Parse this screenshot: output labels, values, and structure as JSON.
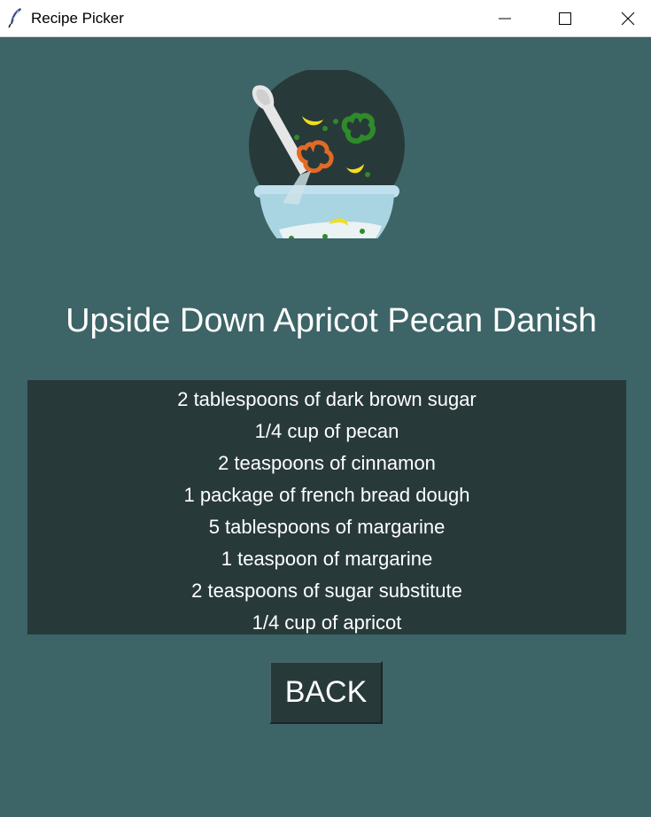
{
  "window": {
    "title": "Recipe Picker",
    "controls": {
      "minimize": "minimize",
      "maximize": "maximize",
      "close": "close"
    }
  },
  "logo": {
    "icon": "mixing-bowl-icon"
  },
  "recipe": {
    "title": "Upside Down Apricot Pecan Danish",
    "ingredients": [
      "2 tablespoons of dark brown sugar",
      "1/4 cup of pecan",
      "2 teaspoons of cinnamon",
      "1 package of french bread dough",
      "5 tablespoons of margarine",
      "1 teaspoon of margarine",
      "2 teaspoons of sugar substitute",
      "1/4 cup of apricot"
    ]
  },
  "actions": {
    "back_label": "BACK"
  },
  "colors": {
    "background": "#3d6466",
    "panel": "#28393a",
    "text": "#ffffff"
  }
}
